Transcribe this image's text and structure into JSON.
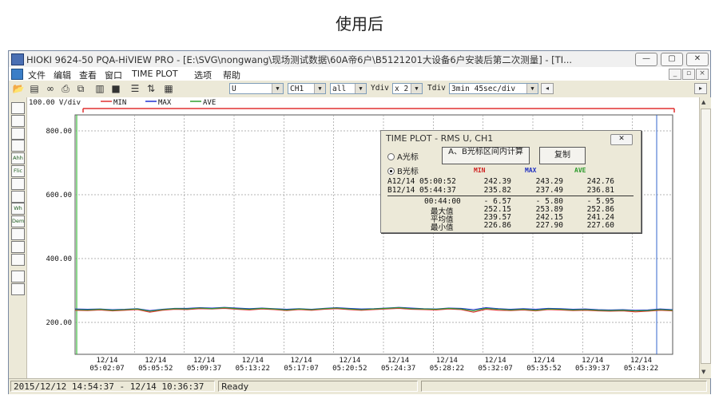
{
  "caption": "使用后",
  "window": {
    "title": "HIOKI 9624-50 PQA-HiVIEW PRO - [E:\\SVG\\nongwang\\现场测试数据\\60A帝6户\\B5121201大设备6户安装后第二次测量] - [TI...",
    "menu": [
      "文件",
      "编辑",
      "查看",
      "窗口",
      "TIME PLOT",
      "选项",
      "帮助"
    ]
  },
  "toolbar": {
    "quantity": "U",
    "channel": "CH1",
    "scope": "all",
    "ydiv_label": "Ydiv",
    "ydiv_value": "x 2",
    "tdiv_label": "Tdiv",
    "tdiv_value": "3min 45sec/div"
  },
  "left_tools": [
    "",
    "",
    "",
    "",
    "Ahh",
    "Flic",
    "",
    "",
    "Wh",
    "Dem",
    "",
    "",
    "",
    "",
    ""
  ],
  "legend": {
    "scale": "100.00 V/div",
    "min": "MIN",
    "max": "MAX",
    "ave": "AVE"
  },
  "popup": {
    "title": "TIME PLOT - RMS  U, CH1",
    "radio_a": "A光标",
    "radio_b": "B光标",
    "selected": "B",
    "calc_button": "A、B光标区间内计算",
    "copy_button": "复制",
    "head_min": "MIN",
    "head_max": "MAX",
    "head_ave": "AVE",
    "rows": [
      [
        "A12/14 05:00:52",
        "242.39",
        "243.29",
        "242.76"
      ],
      [
        "B12/14 05:44:37",
        "235.82",
        "237.49",
        "236.81"
      ],
      [
        "00:44:00",
        "-  6.57",
        "-  5.80",
        "-  5.95"
      ],
      [
        "最大值",
        "252.15",
        "253.89",
        "252.86"
      ],
      [
        "平均值",
        "239.57",
        "242.15",
        "241.24"
      ],
      [
        "最小值",
        "226.86",
        "227.90",
        "227.60"
      ]
    ]
  },
  "status": {
    "range": "2015/12/12 14:54:37 - 12/14 10:36:37",
    "state": "Ready"
  },
  "colors": {
    "min": "#e03030",
    "max": "#2030d0",
    "ave": "#30a030",
    "cursor_a": "#3fbf3f",
    "cursor_b": "#3366cc",
    "range_bar": "#e03030"
  },
  "chart_data": {
    "type": "line",
    "ylim": [
      100,
      850
    ],
    "y_ticks": [
      "800.00",
      "600.00",
      "400.00",
      "200.00"
    ],
    "y_tick_values": [
      800,
      600,
      400,
      200
    ],
    "x_ticks": [
      [
        "12/14",
        "05:02:07"
      ],
      [
        "12/14",
        "05:05:52"
      ],
      [
        "12/14",
        "05:09:37"
      ],
      [
        "12/14",
        "05:13:22"
      ],
      [
        "12/14",
        "05:17:07"
      ],
      [
        "12/14",
        "05:20:52"
      ],
      [
        "12/14",
        "05:24:37"
      ],
      [
        "12/14",
        "05:28:22"
      ],
      [
        "12/14",
        "05:32:07"
      ],
      [
        "12/14",
        "05:35:52"
      ],
      [
        "12/14",
        "05:39:37"
      ],
      [
        "12/14",
        "05:43:22"
      ]
    ],
    "x_start_label": "12/14 05:00:52",
    "x_end_label": "12/14 05:44:37",
    "cursor_a_time": "12/14 05:00:52",
    "cursor_b_time": "12/14 05:44:37",
    "series": [
      {
        "name": "MIN",
        "values": [
          238,
          237,
          239,
          236,
          238,
          240,
          232,
          238,
          241,
          240,
          243,
          242,
          244,
          241,
          239,
          242,
          240,
          237,
          240,
          238,
          241,
          243,
          240,
          238,
          240,
          242,
          244,
          241,
          240,
          239,
          242,
          240,
          232,
          241,
          238,
          237,
          239,
          236,
          240,
          239,
          237,
          238,
          236,
          235,
          236,
          233,
          235,
          238,
          236
        ]
      },
      {
        "name": "MAX",
        "values": [
          242,
          241,
          242,
          240,
          241,
          243,
          237,
          241,
          244,
          244,
          246,
          245,
          247,
          245,
          243,
          245,
          243,
          241,
          243,
          241,
          244,
          246,
          244,
          242,
          243,
          245,
          247,
          245,
          243,
          242,
          245,
          244,
          240,
          246,
          243,
          241,
          243,
          241,
          244,
          243,
          241,
          242,
          240,
          239,
          240,
          238,
          239,
          242,
          240
        ]
      },
      {
        "name": "AVE",
        "values": [
          240,
          239,
          241,
          238,
          240,
          242,
          235,
          240,
          243,
          242,
          245,
          243,
          246,
          243,
          241,
          244,
          242,
          239,
          242,
          240,
          243,
          245,
          242,
          240,
          242,
          244,
          246,
          243,
          242,
          241,
          244,
          242,
          236,
          244,
          241,
          239,
          241,
          238,
          242,
          241,
          239,
          240,
          238,
          237,
          238,
          236,
          237,
          240,
          238
        ]
      }
    ]
  }
}
